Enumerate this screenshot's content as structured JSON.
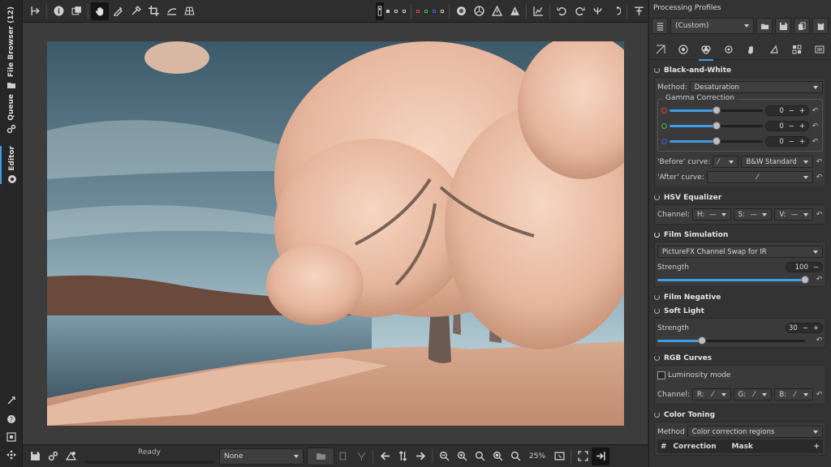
{
  "left_tabs": {
    "file_browser": "File Browser (12)",
    "queue": "Queue",
    "editor": "Editor"
  },
  "bottom": {
    "status": "Ready",
    "preset_value": "None",
    "zoom": "25%"
  },
  "right": {
    "profiles_title": "Processing Profiles",
    "profile_value": "(Custom)",
    "bw": {
      "title": "Black-and-White",
      "method_label": "Method:",
      "method_value": "Desaturation",
      "gamma_title": "Gamma Correction",
      "gamma_r": "0",
      "gamma_g": "0",
      "gamma_b": "0",
      "before_label": "'Before' curve:",
      "before_value": "B&W Standard",
      "after_label": "'After' curve:"
    },
    "hsv": {
      "title": "HSV Equalizer",
      "channel_label": "Channel:",
      "h": "H:",
      "s": "S:",
      "v": "V:"
    },
    "film": {
      "title": "Film Simulation",
      "preset": "PictureFX Channel Swap for IR",
      "strength_label": "Strength",
      "strength_value": "100",
      "strength_level": 1.0
    },
    "film_negative": "Film Negative",
    "soft_light": {
      "title": "Soft Light",
      "strength_label": "Strength",
      "strength_value": "30",
      "strength_level": 0.3
    },
    "rgb": {
      "title": "RGB Curves",
      "luminosity": "Luminosity mode",
      "channel_label": "Channel:",
      "r": "R:",
      "g": "G:",
      "b": "B:"
    },
    "toning": {
      "title": "Color Toning",
      "method_label": "Method",
      "method_value": "Color correction regions",
      "col_hash": "#",
      "col_correction": "Correction",
      "col_mask": "Mask",
      "add": "+"
    }
  },
  "colors": {
    "accent": "#3c9ee8",
    "red": "#e04040",
    "green": "#40c040",
    "blue": "#4060e0"
  }
}
